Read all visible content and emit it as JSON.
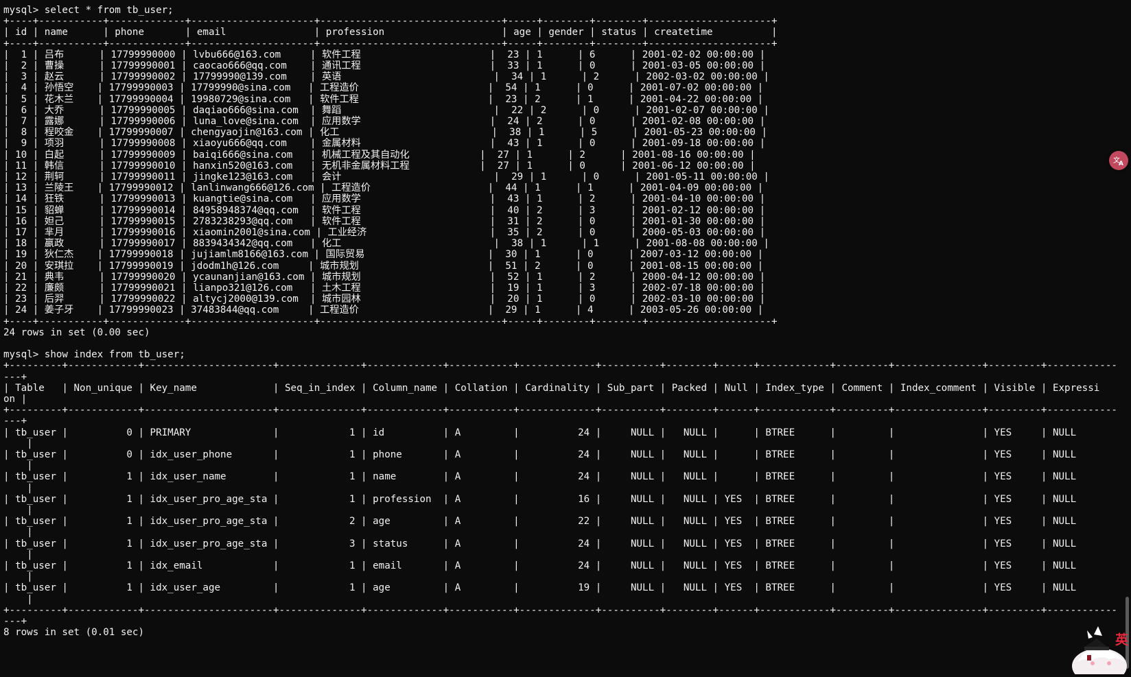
{
  "terminal": {
    "lines": [
      "mysql> select * from tb_user;",
      "+----+-----------+-------------+---------------------+-------------------------------+-----+--------+--------+---------------------+",
      "| id | name      | phone       | email               | profession                    | age | gender | status | createtime          |",
      "+----+-----------+-------------+---------------------+-------------------------------+-----+--------+--------+---------------------+",
      "|  1 | 吕布      | 17799990000 | lvbu666@163.com     | 软件工程                      |  23 | 1      | 6      | 2001-02-02 00:00:00 |",
      "|  2 | 曹操      | 17799990001 | caocao666@qq.com    | 通讯工程                      |  33 | 1      | 0      | 2001-03-05 00:00:00 |",
      "|  3 | 赵云      | 17799990002 | 17799990@139.com    | 英语                          |  34 | 1      | 2      | 2002-03-02 00:00:00 |",
      "|  4 | 孙悟空    | 17799990003 | 17799990@sina.com   | 工程造价                      |  54 | 1      | 0      | 2001-07-02 00:00:00 |",
      "|  5 | 花木兰    | 17799990004 | 19980729@sina.com   | 软件工程                      |  23 | 2      | 1      | 2001-04-22 00:00:00 |",
      "|  6 | 大乔      | 17799990005 | daqiao666@sina.com  | 舞蹈                          |  22 | 2      | 0      | 2001-02-07 00:00:00 |",
      "|  7 | 露娜      | 17799990006 | luna_love@sina.com  | 应用数学                      |  24 | 2      | 0      | 2001-02-08 00:00:00 |",
      "|  8 | 程咬金    | 17799990007 | chengyaojin@163.com | 化工                          |  38 | 1      | 5      | 2001-05-23 00:00:00 |",
      "|  9 | 项羽      | 17799990008 | xiaoyu666@qq.com    | 金属材料                      |  43 | 1      | 0      | 2001-09-18 00:00:00 |",
      "| 10 | 白起      | 17799990009 | baiqi666@sina.com   | 机械工程及其自动化            |  27 | 1      | 2      | 2001-08-16 00:00:00 |",
      "| 11 | 韩信      | 17799990010 | hanxin520@163.com   | 无机非金属材料工程            |  27 | 1      | 0      | 2001-06-12 00:00:00 |",
      "| 12 | 荆轲      | 17799990011 | jingke123@163.com   | 会计                          |  29 | 1      | 0      | 2001-05-11 00:00:00 |",
      "| 13 | 兰陵王    | 17799990012 | lanlinwang666@126.com | 工程造价                    |  44 | 1      | 1      | 2001-04-09 00:00:00 |",
      "| 14 | 狂铁      | 17799990013 | kuangtie@sina.com   | 应用数学                      |  43 | 1      | 2      | 2001-04-10 00:00:00 |",
      "| 15 | 貂蝉      | 17799990014 | 84958948374@qq.com  | 软件工程                      |  40 | 2      | 3      | 2001-02-12 00:00:00 |",
      "| 16 | 妲己      | 17799990015 | 2783238293@qq.com   | 软件工程                      |  31 | 2      | 0      | 2001-01-30 00:00:00 |",
      "| 17 | 芈月      | 17799990016 | xiaomin2001@sina.com | 工业经济                     |  35 | 2      | 0      | 2000-05-03 00:00:00 |",
      "| 18 | 嬴政      | 17799990017 | 8839434342@qq.com   | 化工                          |  38 | 1      | 1      | 2001-08-08 00:00:00 |",
      "| 19 | 狄仁杰    | 17799990018 | jujiamlm8166@163.com | 国际贸易                     |  30 | 1      | 0      | 2007-03-12 00:00:00 |",
      "| 20 | 安琪拉    | 17799990019 | jdodm1h@126.com     | 城市规划                      |  51 | 2      | 0      | 2001-08-15 00:00:00 |",
      "| 21 | 典韦      | 17799990020 | ycaunanjian@163.com | 城市规划                      |  52 | 1      | 2      | 2000-04-12 00:00:00 |",
      "| 22 | 廉颇      | 17799990021 | lianpo321@126.com   | 土木工程                      |  19 | 1      | 3      | 2002-07-18 00:00:00 |",
      "| 23 | 后羿      | 17799990022 | altycj2000@139.com  | 城市园林                      |  20 | 1      | 0      | 2002-03-10 00:00:00 |",
      "| 24 | 姜子牙    | 17799990023 | 37483844@qq.com     | 工程造价                      |  29 | 1      | 4      | 2003-05-26 00:00:00 |",
      "+----+-----------+-------------+---------------------+-------------------------------+-----+--------+--------+---------------------+",
      "24 rows in set (0.00 sec)",
      "",
      "mysql> show index from tb_user;",
      "+---------+------------+----------------------+--------------+-------------+-----------+-------------+----------+--------+------+------------+---------+---------------+---------+------------",
      "---+",
      "| Table   | Non_unique | Key_name             | Seq_in_index | Column_name | Collation | Cardinality | Sub_part | Packed | Null | Index_type | Comment | Index_comment | Visible | Expressi",
      "on |",
      "+---------+------------+----------------------+--------------+-------------+-----------+-------------+----------+--------+------+------------+---------+---------------+---------+------------",
      "---+",
      "| tb_user |          0 | PRIMARY              |            1 | id          | A         |          24 |     NULL |   NULL |      | BTREE      |         |               | YES     | NULL",
      "    |",
      "| tb_user |          0 | idx_user_phone       |            1 | phone       | A         |          24 |     NULL |   NULL |      | BTREE      |         |               | YES     | NULL",
      "    |",
      "| tb_user |          1 | idx_user_name        |            1 | name        | A         |          24 |     NULL |   NULL |      | BTREE      |         |               | YES     | NULL",
      "    |",
      "| tb_user |          1 | idx_user_pro_age_sta |            1 | profession  | A         |          16 |     NULL |   NULL | YES  | BTREE      |         |               | YES     | NULL",
      "    |",
      "| tb_user |          1 | idx_user_pro_age_sta |            2 | age         | A         |          22 |     NULL |   NULL | YES  | BTREE      |         |               | YES     | NULL",
      "    |",
      "| tb_user |          1 | idx_user_pro_age_sta |            3 | status      | A         |          24 |     NULL |   NULL | YES  | BTREE      |         |               | YES     | NULL",
      "    |",
      "| tb_user |          1 | idx_email            |            1 | email       | A         |          24 |     NULL |   NULL | YES  | BTREE      |         |               | YES     | NULL",
      "    |",
      "| tb_user |          1 | idx_user_age         |            1 | age         | A         |          19 |     NULL |   NULL | YES  | BTREE      |         |               | YES     | NULL",
      "    |",
      "+---------+------------+----------------------+--------------+-------------+-----------+-------------+----------+--------+------+------------+---------+---------------+---------+------------",
      "---+",
      "8 rows in set (0.01 sec)"
    ]
  },
  "overlay": {
    "ime_label": "英",
    "translate_icon": "translate-icon",
    "mascot_icon": "mascot-icon"
  },
  "colors": {
    "background": "#0c0c0c",
    "text": "#f2f2f2",
    "translate_button": "#c2485e",
    "ime_label": "#e8283c"
  }
}
